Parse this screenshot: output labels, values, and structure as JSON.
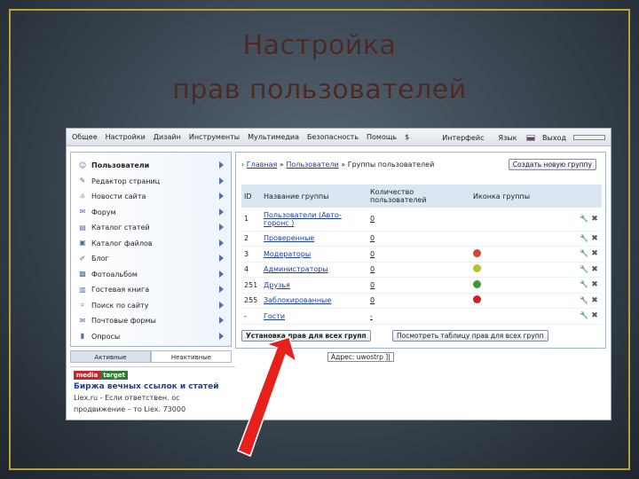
{
  "slide": {
    "title_line1": "Настройка",
    "title_line2": "прав   пользователей"
  },
  "menubar": {
    "items": [
      "Общее",
      "Настройки",
      "Дизайн",
      "Инструменты",
      "Мультимедиа",
      "Безопасность",
      "Помощь",
      "$"
    ],
    "right": {
      "interface": "Интерфейс",
      "language": "Язык",
      "logout": "Выход"
    }
  },
  "sidebar": {
    "items": [
      {
        "label": "Пользователи",
        "icon": "users-icon"
      },
      {
        "label": "Редактор страниц",
        "icon": "page-editor-icon"
      },
      {
        "label": "Новости сайта",
        "icon": "news-icon"
      },
      {
        "label": "Форум",
        "icon": "forum-icon"
      },
      {
        "label": "Каталог статей",
        "icon": "articles-icon"
      },
      {
        "label": "Каталог файлов",
        "icon": "files-icon"
      },
      {
        "label": "Блог",
        "icon": "blog-icon"
      },
      {
        "label": "Фотоальбом",
        "icon": "photo-icon"
      },
      {
        "label": "Гостевая книга",
        "icon": "guestbook-icon"
      },
      {
        "label": "Поиск по сайту",
        "icon": "search-icon"
      },
      {
        "label": "Почтовые формы",
        "icon": "mail-form-icon"
      },
      {
        "label": "Опросы",
        "icon": "polls-icon"
      }
    ],
    "tabs": [
      "Активные",
      "Неактивные"
    ]
  },
  "ad": {
    "logo_part1": "media",
    "logo_part2": "target",
    "title": "Биржа вечных ссылок и статей",
    "text_line1": "Liex.ru - Если ответствен. ос",
    "text_line2": "продвижение – то Liex. 73000"
  },
  "panel": {
    "breadcrumb": {
      "home": "Главная",
      "users": "Пользователи",
      "current": "Группы пользователей"
    },
    "create_button": "Создать новую группу",
    "headers": {
      "id": "ID",
      "name": "Название группы",
      "count": "Количество пользователей",
      "icon": "Иконка группы"
    },
    "rows": [
      {
        "id": "1",
        "name": "Пользователи (Авто-горонс )",
        "count": "0",
        "icon": ""
      },
      {
        "id": "2",
        "name": "Проверенные",
        "count": "0",
        "icon": ""
      },
      {
        "id": "3",
        "name": "Модераторы",
        "count": "0",
        "icon": "moderator-badge-icon"
      },
      {
        "id": "4",
        "name": "Администраторы",
        "count": "0",
        "icon": "admin-badge-icon"
      },
      {
        "id": "251",
        "name": "Друзья",
        "count": "0",
        "icon": "friends-icon"
      },
      {
        "id": "255",
        "name": "Заблокированные",
        "count": "0",
        "icon": "blocked-icon"
      },
      {
        "id": "-",
        "name": "Гости",
        "count": "-",
        "icon": ""
      }
    ],
    "set_rights_button": "Установка прав для всех групп",
    "view_table_button": "Посмотреть таблицу прав для всех групп"
  },
  "address": "Адрес: uwostrp ]|",
  "colors": {
    "title": "#4a2a22",
    "frame": "#b8a23a",
    "link": "#1a3fa8",
    "arrow": "#e8201c",
    "header_bg": "#dbe6f3"
  }
}
